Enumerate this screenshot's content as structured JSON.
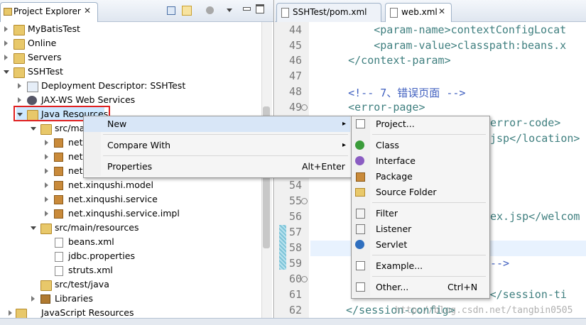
{
  "explorer": {
    "title": "Project Explorer",
    "close": "✕",
    "tree": [
      {
        "label": "MyBatisTest"
      },
      {
        "label": "Online"
      },
      {
        "label": "Servers"
      },
      {
        "label": "SSHTest"
      },
      {
        "label": "Deployment Descriptor: SSHTest"
      },
      {
        "label": "JAX-WS Web Services"
      },
      {
        "label": "Java Resources"
      },
      {
        "label": "src/ma"
      },
      {
        "label": "net."
      },
      {
        "label": "net."
      },
      {
        "label": "net."
      },
      {
        "label": "net.xinqushi.model"
      },
      {
        "label": "net.xinqushi.service"
      },
      {
        "label": "net.xinqushi.service.impl"
      },
      {
        "label": "src/main/resources"
      },
      {
        "label": "beans.xml"
      },
      {
        "label": "jdbc.properties"
      },
      {
        "label": "struts.xml"
      },
      {
        "label": "src/test/java"
      },
      {
        "label": "Libraries"
      },
      {
        "label": "JavaScript Resources"
      }
    ]
  },
  "editor": {
    "tabs": [
      {
        "label": "SSHTest/pom.xml"
      },
      {
        "label": "web.xml",
        "close": "✕"
      }
    ],
    "lines": [
      {
        "n": "44",
        "code": "        <param-name>contextConfigLocat"
      },
      {
        "n": "45",
        "code": "        <param-value>classpath:beans.x"
      },
      {
        "n": "46",
        "code": "    </context-param>"
      },
      {
        "n": "47",
        "code": ""
      },
      {
        "n": "48",
        "code": "    <!-- 7、错误页面 -->"
      },
      {
        "n": "49",
        "code": "    <error-page>"
      },
      {
        "n": "54",
        "code": ""
      },
      {
        "n": "55",
        "code": ""
      },
      {
        "n": "56",
        "code": ""
      },
      {
        "n": "57",
        "code": ""
      },
      {
        "n": "58",
        "code": ""
      },
      {
        "n": "59",
        "code": ""
      },
      {
        "n": "60",
        "code": ""
      },
      {
        "n": "61",
        "code": ""
      },
      {
        "n": "62",
        "code": ""
      }
    ],
    "fragments": {
      "error_code": "error-code>",
      "jsp_location": "jsp</location>",
      "welcome": "ex.jsp</welcom",
      "comment_end": "-->",
      "session": "<session-timeout>30</session-ti",
      "session_close": "</session-config>",
      "watermark": "http://blog.csdn.net/tangbin0505"
    }
  },
  "context_menu": {
    "items": [
      {
        "label": "New",
        "arrow": "▸"
      },
      {
        "label": "Compare With",
        "arrow": "▸"
      },
      {
        "label": "Properties",
        "shortcut": "Alt+Enter"
      }
    ]
  },
  "submenu": {
    "items": [
      {
        "label": "Project..."
      },
      {
        "label": "Class"
      },
      {
        "label": "Interface"
      },
      {
        "label": "Package"
      },
      {
        "label": "Source Folder"
      },
      {
        "label": "Filter"
      },
      {
        "label": "Listener"
      },
      {
        "label": "Servlet"
      },
      {
        "label": "Example..."
      },
      {
        "label": "Other...",
        "shortcut": "Ctrl+N"
      }
    ]
  },
  "colors": {
    "highlight_box": "#e02020",
    "selected_row": "#cde8ff"
  }
}
